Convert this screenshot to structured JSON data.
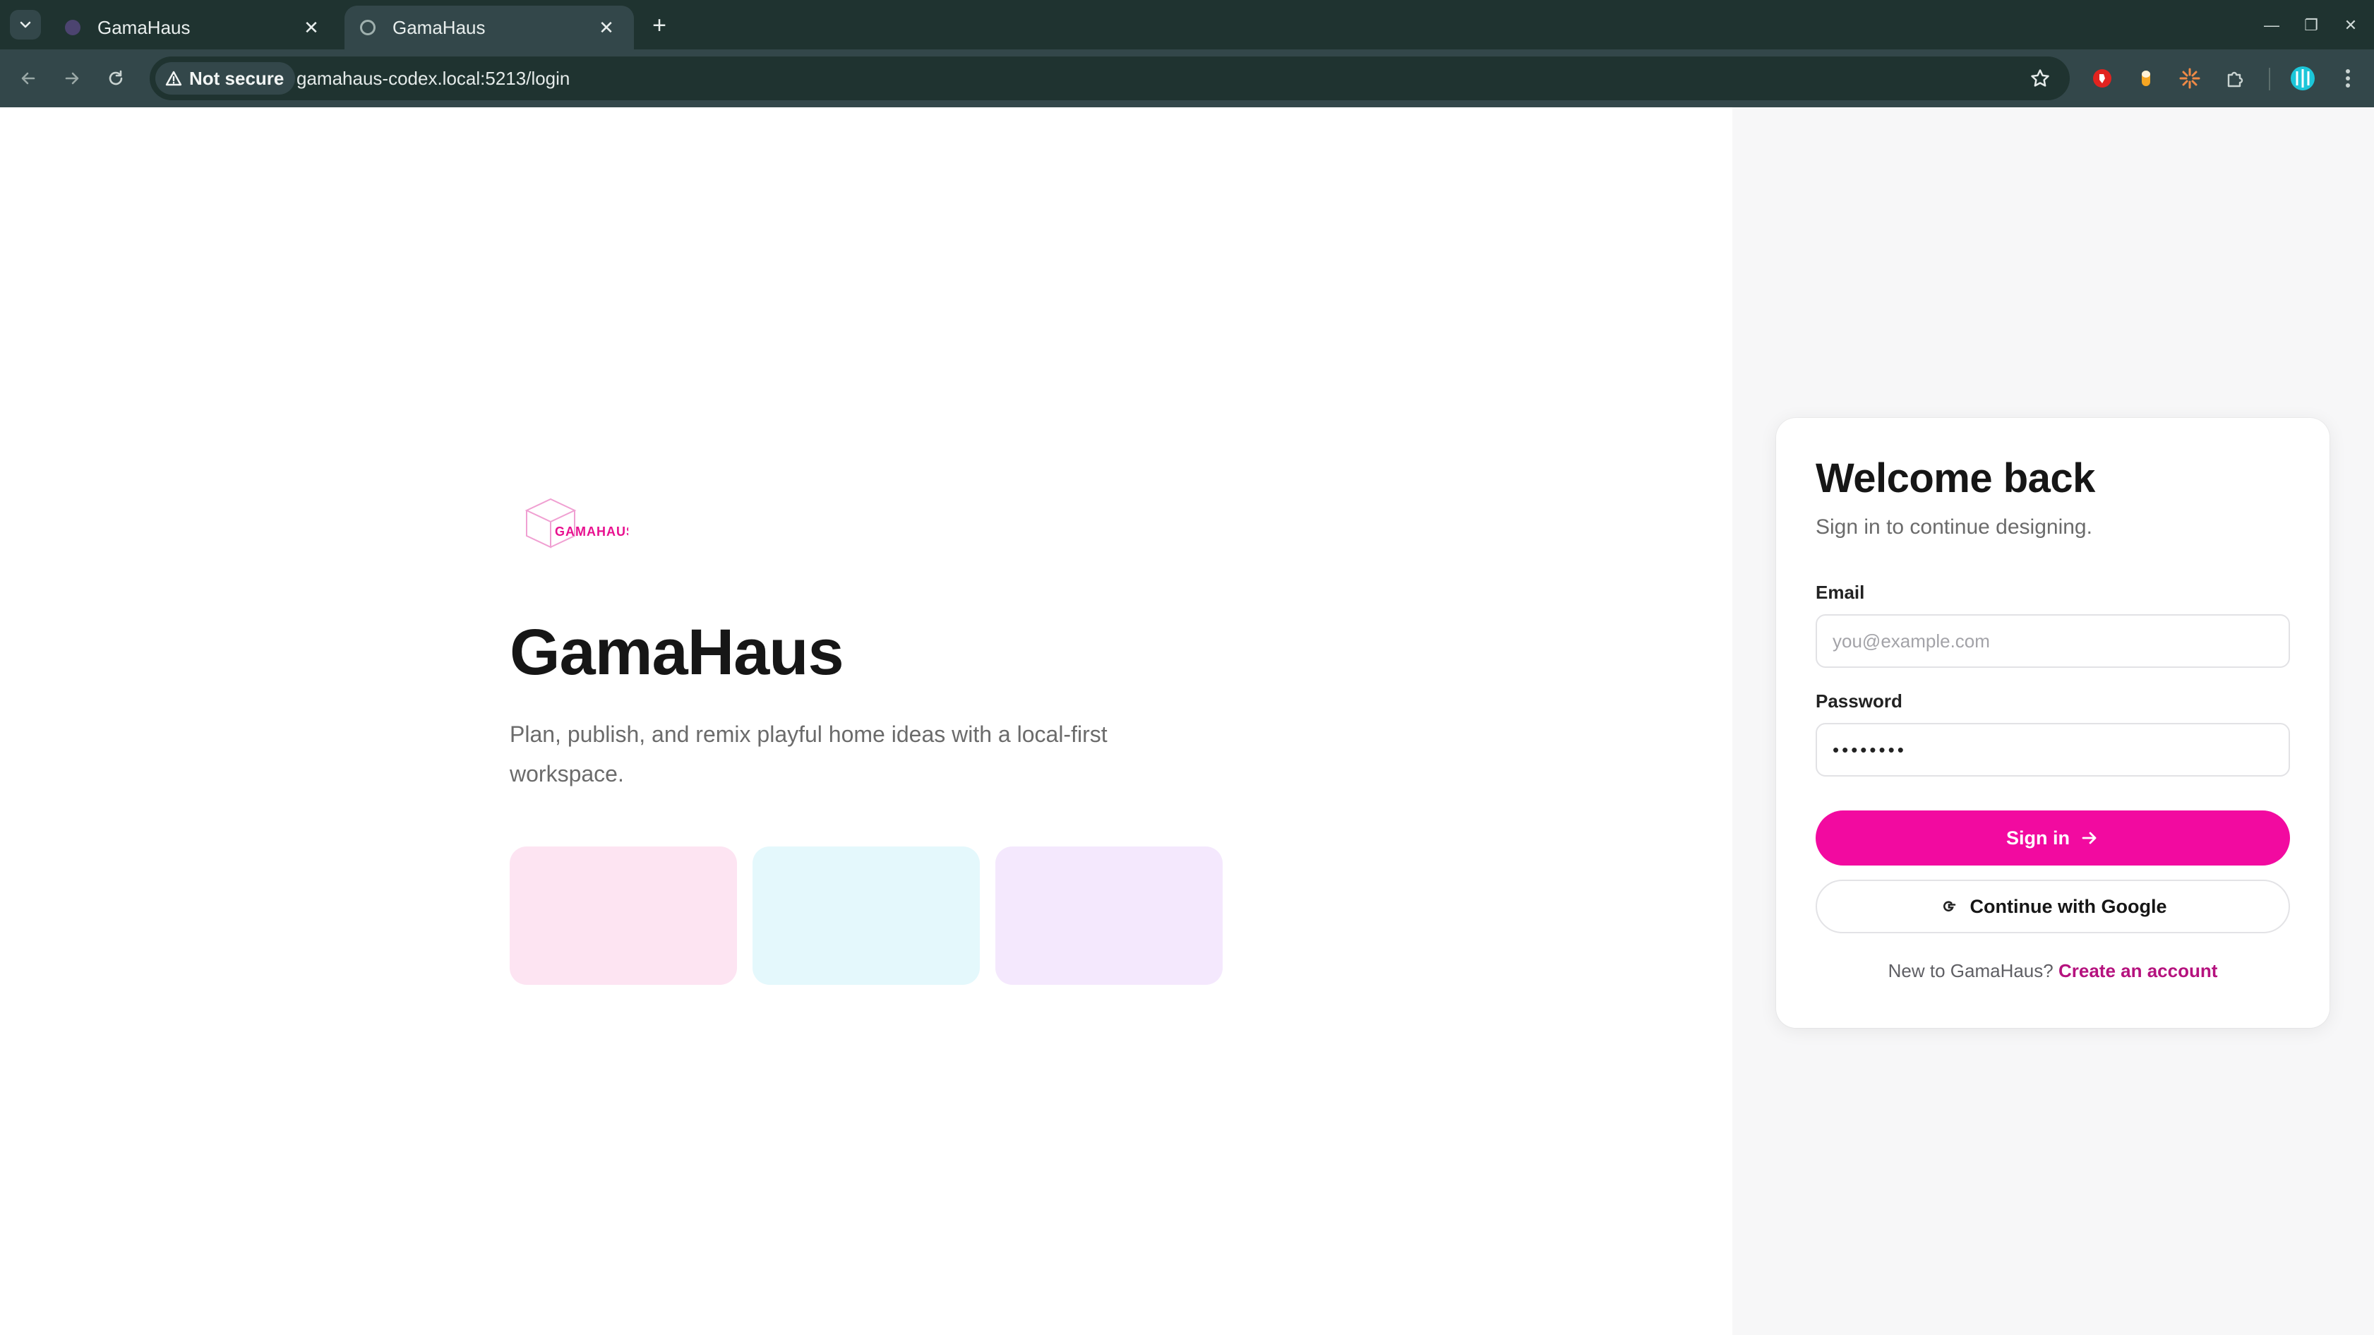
{
  "browser": {
    "tabs": [
      {
        "title": "GamaHaus",
        "active": false
      },
      {
        "title": "GamaHaus",
        "active": true
      }
    ],
    "security_label": "Not secure",
    "url": "gamahaus-codex.local:5213/login"
  },
  "hero": {
    "logo_text": "GAMAHAUS",
    "title": "GamaHaus",
    "tagline": "Plan, publish, and remix playful home ideas with a local-first workspace.",
    "swatch_colors": [
      "#fde4f2",
      "#e4f8fc",
      "#f4e8fd"
    ]
  },
  "login": {
    "title": "Welcome back",
    "subtitle": "Sign in to continue designing.",
    "email_label": "Email",
    "email_placeholder": "you@example.com",
    "password_label": "Password",
    "password_value": "password",
    "sign_in_label": "Sign in",
    "google_label": "Continue with Google",
    "signup_prompt": "New to GamaHaus?",
    "signup_link": "Create an account"
  },
  "colors": {
    "accent": "#f20aa0",
    "link": "#b5127e",
    "chrome_dark": "#1f3330",
    "chrome_toolbar": "#33474a"
  },
  "icons": [
    "tab-search-icon",
    "close-icon",
    "new-tab-icon",
    "back-icon",
    "forward-icon",
    "reload-icon",
    "warning-icon",
    "star-icon",
    "extension-icon",
    "profile-avatar",
    "menu-icon",
    "arrow-right-icon",
    "google-icon",
    "minimize-icon",
    "restore-icon"
  ]
}
